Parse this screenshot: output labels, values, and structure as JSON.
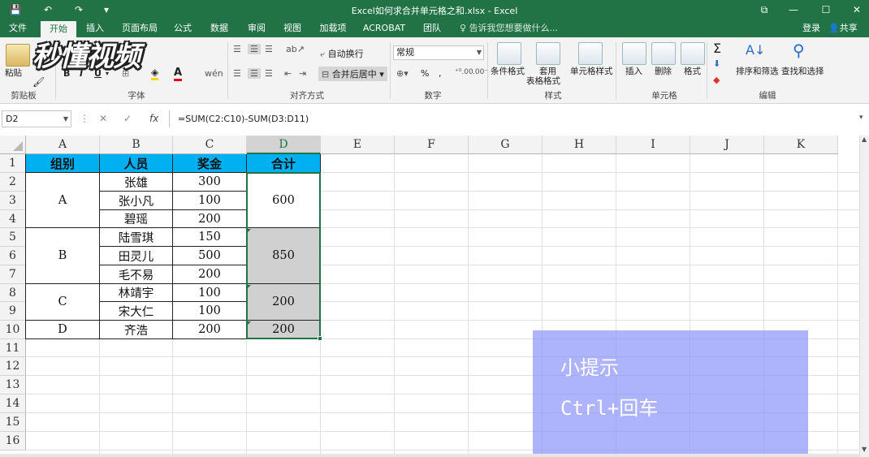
{
  "titlebar": {
    "title": "Excel如何求合并单元格之和.xlsx - Excel",
    "save_icon": "💾",
    "undo_icon": "↶",
    "redo_icon": "↷",
    "customize_icon": "▾",
    "restore_icon": "⧉",
    "minimize_icon": "—",
    "maximize_icon": "☐",
    "close_icon": "✕"
  },
  "tabs": [
    "文件",
    "开始",
    "插入",
    "页面布局",
    "公式",
    "数据",
    "审阅",
    "视图",
    "加载项",
    "ACROBAT",
    "团队"
  ],
  "active_tab": "开始",
  "tell_me": "告诉我您想要做什么...",
  "login": "登录",
  "share": "共享",
  "watermark": "秒懂视频",
  "ribbon": {
    "paste": "粘贴",
    "clipboard": "剪贴板",
    "font": "字体",
    "bold": "B",
    "italic": "I",
    "underline": "U",
    "wrap_text": "自动换行",
    "merge_center": "合并后居中",
    "alignment": "对齐方式",
    "number_format": "常规",
    "percent": "%",
    "comma": ",",
    "number": "数字",
    "conditional_format": "条件格式",
    "table_format_1": "套用",
    "table_format_2": "表格格式",
    "cell_styles": "单元格样式",
    "styles": "样式",
    "insert": "插入",
    "delete": "删除",
    "format": "格式",
    "cells": "单元格",
    "sort_filter": "排序和筛选",
    "find_select": "查找和选择",
    "editing": "编辑",
    "sigma": "Σ"
  },
  "formula_bar": {
    "name_box": "D2",
    "formula": "=SUM(C2:C10)-SUM(D3:D11)",
    "cancel": "✕",
    "enter": "✓",
    "fx": "fx"
  },
  "columns": [
    "A",
    "B",
    "C",
    "D",
    "E",
    "F",
    "G",
    "H",
    "I",
    "J",
    "K"
  ],
  "rows": [
    "1",
    "2",
    "3",
    "4",
    "5",
    "6",
    "7",
    "8",
    "9",
    "10",
    "11",
    "12",
    "13",
    "14",
    "15",
    "16"
  ],
  "table": {
    "headers": [
      "组别",
      "人员",
      "奖金",
      "合计"
    ],
    "groups": [
      "A",
      "B",
      "C",
      "D"
    ],
    "people": [
      "张雄",
      "张小凡",
      "碧瑶",
      "陆雪琪",
      "田灵儿",
      "毛不易",
      "林靖宇",
      "宋大仁",
      "齐浩"
    ],
    "bonus": [
      "300",
      "100",
      "200",
      "150",
      "500",
      "200",
      "100",
      "100",
      "200"
    ],
    "totals": [
      "600",
      "850",
      "200",
      "200"
    ]
  },
  "tip": {
    "line1": "小提示",
    "line2": "Ctrl+回车"
  }
}
